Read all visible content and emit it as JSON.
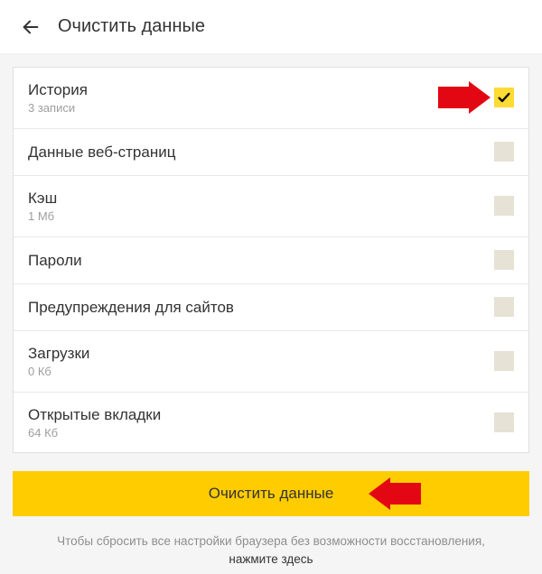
{
  "header": {
    "title": "Очистить данные"
  },
  "items": [
    {
      "label": "История",
      "sub": "3 записи",
      "checked": true
    },
    {
      "label": "Данные веб-страниц",
      "sub": "",
      "checked": false
    },
    {
      "label": "Кэш",
      "sub": "1 Мб",
      "checked": false
    },
    {
      "label": "Пароли",
      "sub": "",
      "checked": false
    },
    {
      "label": "Предупреждения для сайтов",
      "sub": "",
      "checked": false
    },
    {
      "label": "Загрузки",
      "sub": "0 Кб",
      "checked": false
    },
    {
      "label": "Открытые вкладки",
      "sub": "64 Кб",
      "checked": false
    }
  ],
  "clear_button": {
    "label": "Очистить данные"
  },
  "footer": {
    "text": "Чтобы сбросить все настройки браузера без возможности восстановления,",
    "link": "нажмите здесь"
  },
  "colors": {
    "accent": "#FFCC00",
    "highlight_arrow": "#E30613"
  }
}
